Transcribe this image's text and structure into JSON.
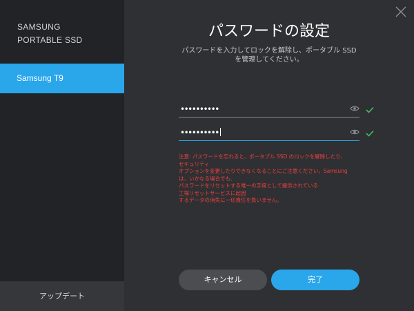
{
  "sidebar": {
    "brand": "SAMSUNG\nPORTABLE SSD",
    "device_label": "Samsung T9",
    "update_label": "アップデート"
  },
  "header": {
    "title": "パスワードの設定",
    "subtitle": "パスワードを入力してロックを解除し、ポータブル SSD\nを管理してください。"
  },
  "form": {
    "password": "••••••••••",
    "confirm_password": "••••••••••"
  },
  "warning": "注意: パスワードを忘れると、ポータブル SSD のロックを解除したり、\nセキュリティ\nオプションを変更したりできなくなることにご注意ください。Samsung\nは、いかなる場合でも、\nパスワードをリセットする唯一の手段として提供されている\n工場リセットサービスに起因\nするデータの消失に一切責任を負いません。",
  "buttons": {
    "cancel": "キャンセル",
    "done": "完了"
  },
  "colors": {
    "accent": "#2aa6eb",
    "warning": "#ef3f3f",
    "valid": "#3fbf5f",
    "sidebar_bg": "#222326",
    "main_bg": "#2f3033"
  },
  "icons": {
    "close": "close-icon",
    "eye": "eye-icon",
    "check": "checkmark-icon"
  }
}
